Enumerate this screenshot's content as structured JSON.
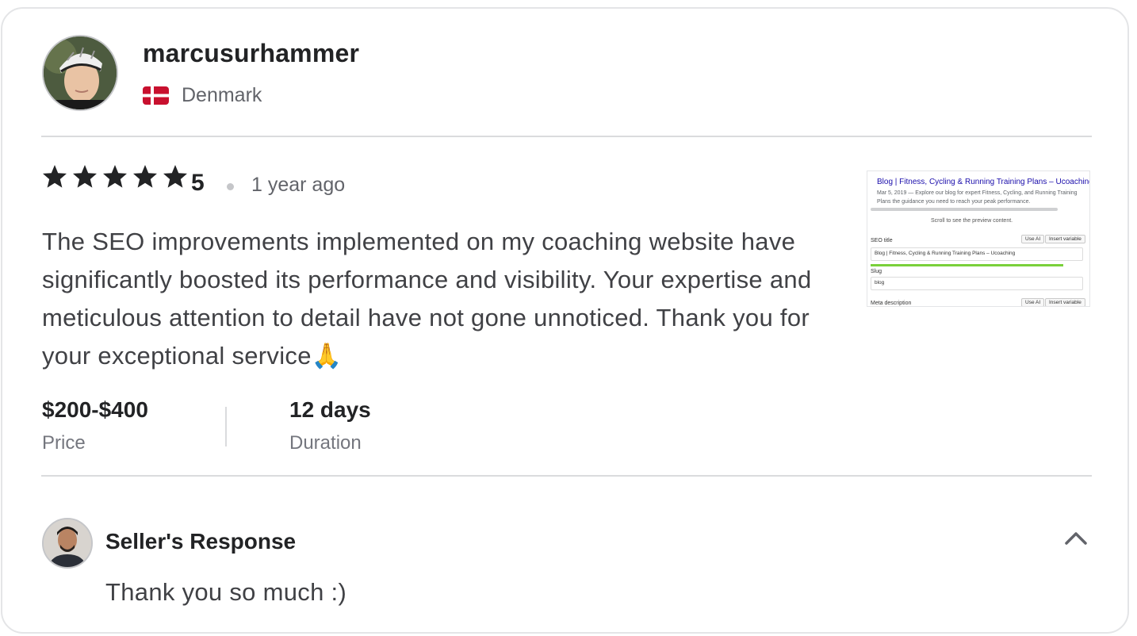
{
  "reviewer": {
    "username": "marcusurhammer",
    "country": "Denmark",
    "flag": "denmark-flag"
  },
  "review": {
    "rating": 5,
    "rating_label": "5",
    "time_ago": "1 year ago",
    "text": "The SEO improvements implemented on my coaching website have significantly boosted its performance and visibility. Your expertise and meticulous attention to detail have not gone unnoticed. Thank you for your exceptional service🙏"
  },
  "attachment": {
    "title": "Blog | Fitness, Cycling & Running Training Plans – Ucoaching",
    "meta": "Mar 5, 2019 — Explore our blog for expert Fitness, Cycling, and Running Training Plans the guidance you need to reach your peak performance.",
    "scroll_hint": "Scroll to see the preview content.",
    "seo_title_label": "SEO title",
    "use_ai": "Use AI",
    "insert_variable": "Insert variable",
    "seo_title_value": "Blog | Fitness, Cycling & Running Training Plans – Ucoaching",
    "slug_label": "Slug",
    "slug_value": "blog",
    "meta_label": "Meta description"
  },
  "stats": {
    "price_value": "$200-$400",
    "price_label": "Price",
    "duration_value": "12 days",
    "duration_label": "Duration"
  },
  "seller_response": {
    "title": "Seller's Response",
    "text": "Thank you so much :)",
    "collapse_icon": "chevron-up-icon"
  },
  "colors": {
    "star": "#222325",
    "divider": "#dadbdd",
    "muted_text": "#62646a",
    "flag_red": "#c8102e"
  }
}
